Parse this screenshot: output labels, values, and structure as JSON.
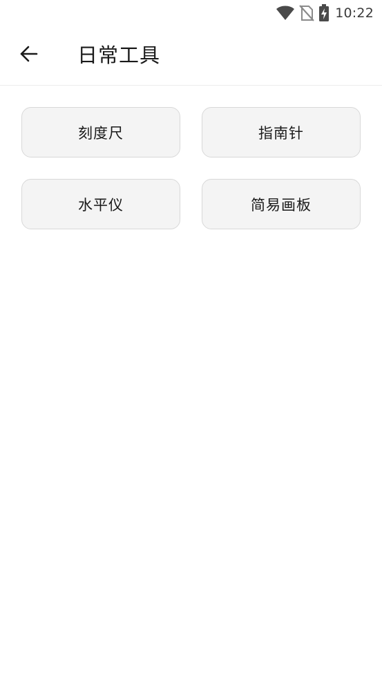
{
  "status_bar": {
    "time": "10:22",
    "icons": [
      "wifi-icon",
      "no-sim-icon",
      "battery-charging-icon"
    ]
  },
  "header": {
    "back_icon": "arrow-back-icon",
    "title": "日常工具"
  },
  "tools": [
    {
      "label": "刻度尺"
    },
    {
      "label": "指南针"
    },
    {
      "label": "水平仪"
    },
    {
      "label": "简易画板"
    }
  ],
  "colors": {
    "button_bg": "#f4f4f4",
    "button_border": "#d8d8d8",
    "text": "#1a1a1a",
    "divider": "#ececec"
  }
}
